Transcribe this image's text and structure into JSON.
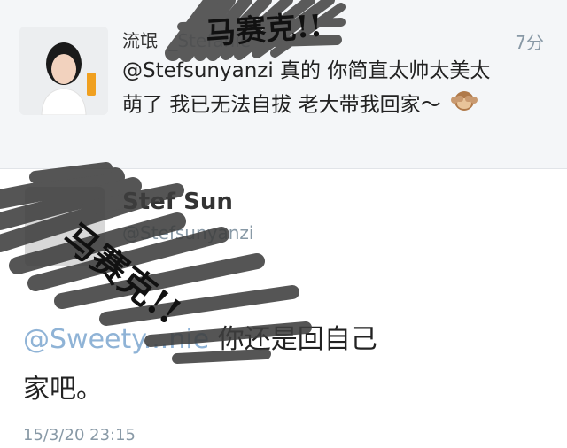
{
  "top_tweet": {
    "name": "流氓",
    "handle": "_Stefanie",
    "time": "7分",
    "text_line1": "@Stefsunyanzi 真的 你简直太帅太美太",
    "text_line2": "萌了 我已无法自拔 老大带我回家～",
    "emoji": "see-no-evil-monkey"
  },
  "main_tweet": {
    "name": "Stef Sun",
    "handle": "@Stefsunyanzi",
    "reply_mention": "@Sweety",
    "reply_mention_tail": "...nie",
    "reply_text_line1": " 你还是回自己",
    "reply_text_line2": "家吧。",
    "timestamp": "15/3/20 23:15"
  },
  "overlay": {
    "caption_top": "马赛克!!",
    "caption_middle": "马赛克!!"
  }
}
